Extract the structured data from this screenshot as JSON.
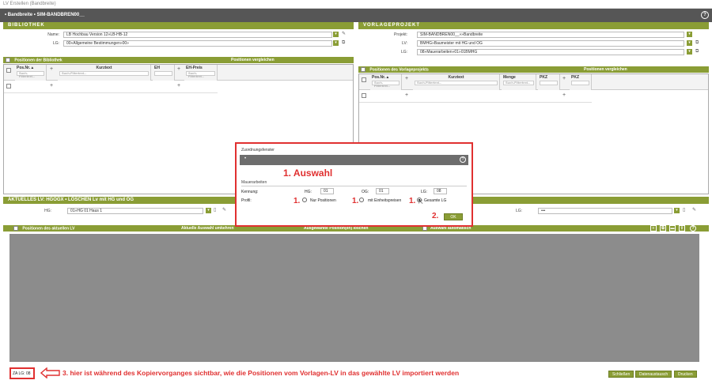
{
  "window": {
    "title": "LV Erstellen (Bandbreite)"
  },
  "appbar": {
    "title": "• Bandbreite • SIM-BANDBREN00__"
  },
  "bibliothek": {
    "heading": "BIBLIOTHEK",
    "name_label": "Name:",
    "name_value": "LB Hochbau Version 12»LB-HB-12",
    "lg_label": "LG:",
    "lg_value": "00»Allgemeine Bestimmungen»00»",
    "grid_header_left": "Positionen der Bibliothek",
    "grid_header_right": "Positionen vergleichen",
    "columns": [
      "Pos.Nr.",
      "Kurztext",
      "EH",
      "EH-Preis"
    ],
    "filter_placeholder": "Such-Filtertext..."
  },
  "vorlageprojekt": {
    "heading": "VORLAGEPROJEKT",
    "projekt_label": "Projekt:",
    "projekt_value": "SIM-BANDBREN00__»»Bandbreite",
    "lv_label": "LV:",
    "lv_value": "BMHG»Baumeister mit HG und OG",
    "lg_label": "LG:",
    "lg_value": "08»Mauerarbeiten»01»01BMHG",
    "grid_header_left": "Positionen des Vorlageprojekts",
    "grid_header_right": "Positionen vergleichen",
    "columns": [
      "Pos.Nr.",
      "Kurztext",
      "Menge",
      "PKZ",
      "PKZ"
    ],
    "filter_placeholder": "Such-Filtertext..."
  },
  "aktuelles": {
    "heading": "AKTUELLES LV: HGOGX • LÖSCHEN Lv mit HG und OG",
    "hg_label": "HG:",
    "hg_value": "01»HG 01 Haus 1",
    "lg_label": "LG:",
    "lg_value": "•••",
    "bar_left": "Positionen des aktuellen LV",
    "bar_mid": "Aktuelle Auswahl umkehren",
    "bar_mid2": "Ausgewählte Position(en) löschen",
    "bar_right": "Auswahl automatisch"
  },
  "dialog": {
    "title": "Zuordnungsfenster",
    "subbar": "•",
    "annotation": "1. Auswahl",
    "section": "Mauerarbeiten",
    "kennung_label": "Kennung:",
    "hg_label": "HG:",
    "hg_value": "01",
    "og_label": "OG:",
    "og_value": "01",
    "lg_label": "LG:",
    "lg_value": "08",
    "profil_label": "Profil:",
    "num1": "1.",
    "opt1": "Nur Positionen",
    "opt2": "mit Einheitspreisen",
    "opt3": "Gesamte LG",
    "ok_annotation": "2.",
    "ok_label": "OK"
  },
  "footer": {
    "status": "ZA LG: 08",
    "annotation": "3. hier ist während des Kopiervorganges sichtbar, wie die Positionen vom Vorlagen-LV in das gewählte LV importiert werden",
    "btn_close": "Schließen",
    "btn_exchange": "Datenaustausch",
    "btn_print": "Drucken"
  },
  "colors": {
    "accent": "#8a9d35",
    "annotation": "#e03030",
    "appbar": "#565656"
  }
}
